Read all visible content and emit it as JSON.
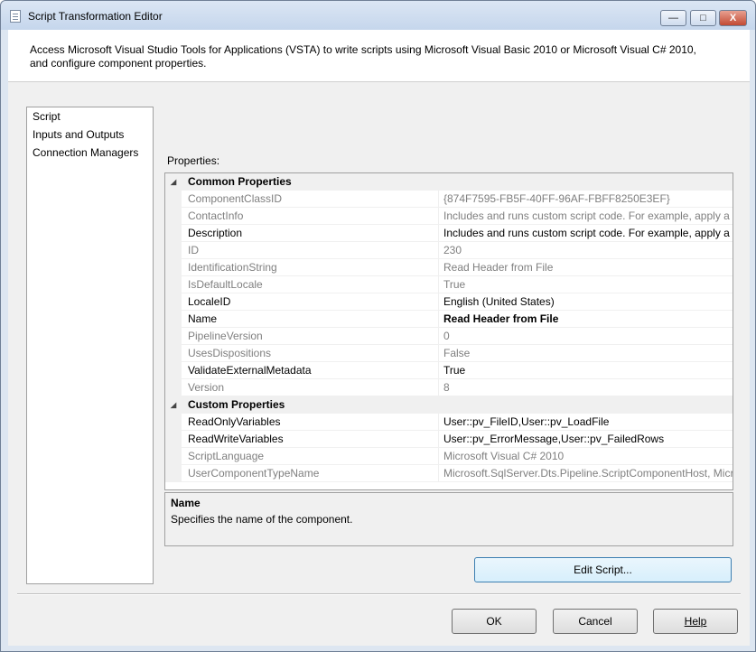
{
  "window": {
    "title": "Script Transformation Editor",
    "minimize": "—",
    "maximize": "□",
    "close": "X"
  },
  "header": {
    "description": "Access Microsoft Visual Studio Tools for Applications (VSTA) to write scripts using Microsoft Visual Basic 2010 or Microsoft Visual C# 2010, and configure component properties."
  },
  "nav": {
    "items": [
      {
        "label": "Script"
      },
      {
        "label": "Inputs and Outputs"
      },
      {
        "label": "Connection Managers"
      }
    ]
  },
  "properties": {
    "label": "Properties:",
    "common": {
      "category": "Common Properties",
      "rows": [
        {
          "name": "ComponentClassID",
          "value": "{874F7595-FB5F-40FF-96AF-FBFF8250E3EF}"
        },
        {
          "name": "ContactInfo",
          "value": "Includes and runs custom script code. For example, apply a b"
        },
        {
          "name": "Description",
          "value": "Includes and runs custom script code. For example, apply a b"
        },
        {
          "name": "ID",
          "value": "230"
        },
        {
          "name": "IdentificationString",
          "value": "Read Header from File"
        },
        {
          "name": "IsDefaultLocale",
          "value": "True"
        },
        {
          "name": "LocaleID",
          "value": "English (United States)"
        },
        {
          "name": "Name",
          "value": "Read Header from File"
        },
        {
          "name": "PipelineVersion",
          "value": "0"
        },
        {
          "name": "UsesDispositions",
          "value": "False"
        },
        {
          "name": "ValidateExternalMetadata",
          "value": "True"
        },
        {
          "name": "Version",
          "value": "8"
        }
      ]
    },
    "custom": {
      "category": "Custom Properties",
      "rows": [
        {
          "name": "ReadOnlyVariables",
          "value": "User::pv_FileID,User::pv_LoadFile"
        },
        {
          "name": "ReadWriteVariables",
          "value": "User::pv_ErrorMessage,User::pv_FailedRows"
        },
        {
          "name": "ScriptLanguage",
          "value": "Microsoft Visual C# 2010"
        },
        {
          "name": "UserComponentTypeName",
          "value": "Microsoft.SqlServer.Dts.Pipeline.ScriptComponentHost, Micr"
        }
      ]
    }
  },
  "description_panel": {
    "title": "Name",
    "text": "Specifies the name of the component."
  },
  "buttons": {
    "edit_script": "Edit Script...",
    "ok": "OK",
    "cancel": "Cancel",
    "help": "Help"
  }
}
